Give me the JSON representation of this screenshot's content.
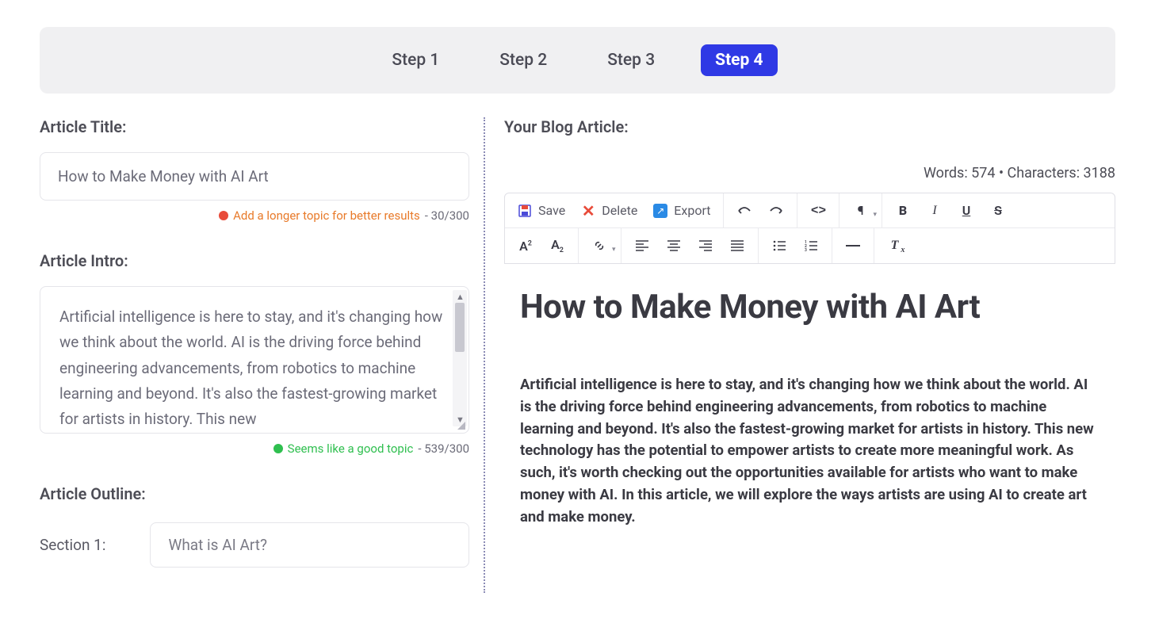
{
  "steps": {
    "items": [
      {
        "label": "Step 1"
      },
      {
        "label": "Step 2"
      },
      {
        "label": "Step 3"
      },
      {
        "label": "Step 4"
      }
    ],
    "active_index": 3
  },
  "left": {
    "title_label": "Article Title:",
    "title_value": "How to Make Money with AI Art",
    "title_hint": "Add a longer topic for better results",
    "title_count": "- 30/300",
    "intro_label": "Article Intro:",
    "intro_value": "Artificial intelligence is here to stay, and it's changing how we think about the world. AI is the driving force behind engineering advancements, from robotics to machine learning and beyond. It's also the fastest-growing market for artists in history. This new",
    "intro_hint": "Seems like a good topic",
    "intro_count": "- 539/300",
    "outline_label": "Article Outline:",
    "section_1_label": "Section 1:",
    "section_1_value": "What is AI Art?"
  },
  "right": {
    "header": "Your Blog Article:",
    "stats": "Words: 574 • Characters: 3188",
    "toolbar": {
      "save": "Save",
      "delete": "Delete",
      "export": "Export"
    },
    "article": {
      "title": "How to Make Money with AI Art",
      "intro": "Artificial intelligence is here to stay, and it's changing how we think about the world. AI is the driving force behind engineering advancements, from robotics to machine learning and beyond. It's also the fastest-growing market for artists in history. This new technology has the potential to empower artists to create more meaningful work. As such, it's worth checking out the opportunities available for artists who want to make money with AI. In this article, we will explore the ways artists are using AI to create art and make money."
    }
  }
}
